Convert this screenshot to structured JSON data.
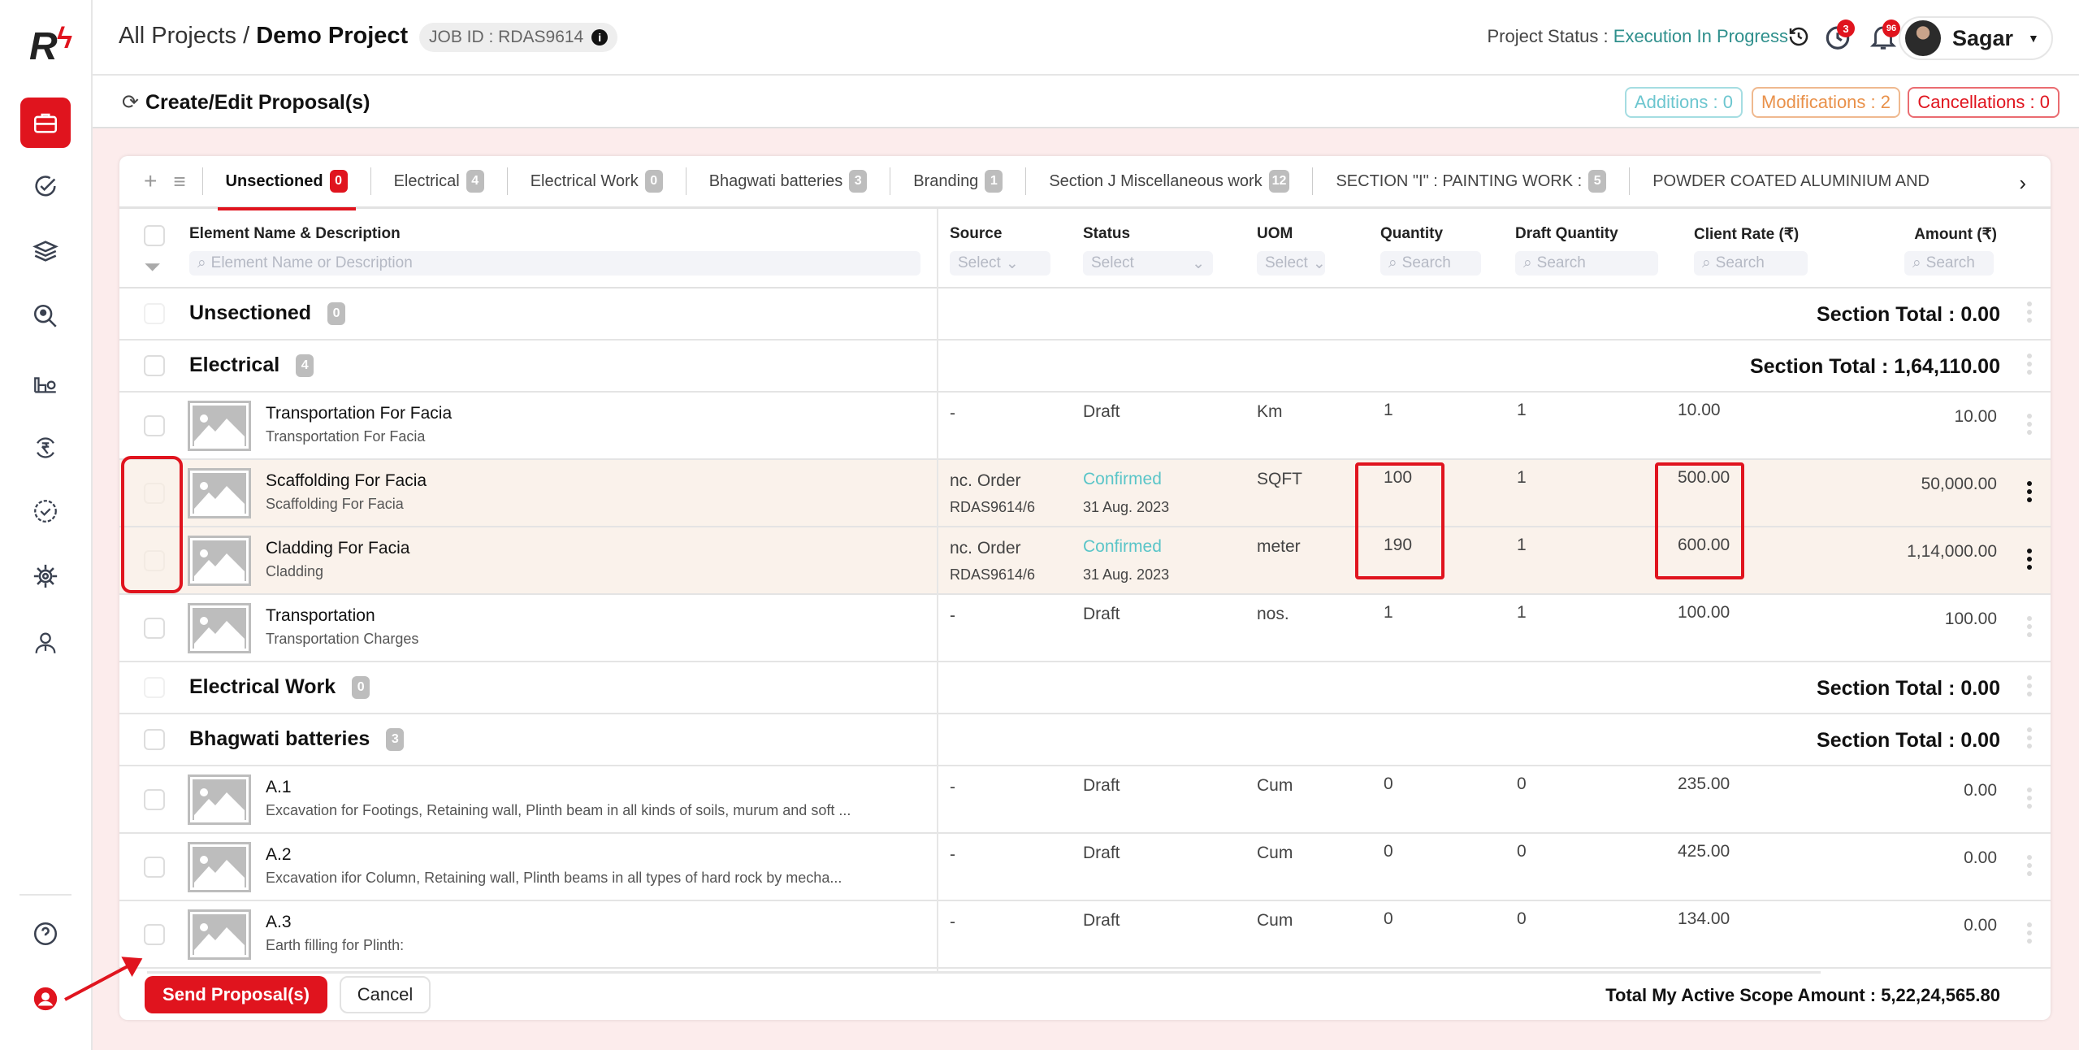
{
  "header": {
    "breadcrumb_root": "All Projects",
    "breadcrumb_sep": "/",
    "project_name": "Demo Project",
    "job_id": "JOB ID : RDAS9614",
    "status_label": "Project Status : ",
    "status_value": "Execution In Progress",
    "timer_badge": "3",
    "notification_badge": "96",
    "user_name": "Sagar"
  },
  "subheader": {
    "title": "Create/Edit Proposal(s)",
    "additions": "Additions : 0",
    "modifications": "Modifications : 2",
    "cancellations": "Cancellations : 0"
  },
  "colors": {
    "accent": "#e0141e",
    "status_teal": "#2e8f8c",
    "confirmed": "#5ac5c8",
    "additions": "#6cc6cf",
    "modifications": "#e9914a",
    "cancellations": "#e0141e"
  },
  "sidebar": {
    "items": [
      "projects-icon",
      "tasks-check-icon",
      "layers-icon",
      "people-search-icon",
      "site-worker-icon",
      "rupee-cycle-icon",
      "verified-badge-icon",
      "settings-network-icon",
      "user-manager-icon"
    ],
    "bottom": [
      "help-icon",
      "support-agent-icon"
    ]
  },
  "tabs": [
    {
      "label": "Unsectioned",
      "count": "0",
      "active": true
    },
    {
      "label": "Electrical",
      "count": "4"
    },
    {
      "label": "Electrical Work",
      "count": "0"
    },
    {
      "label": "Bhagwati batteries",
      "count": "3"
    },
    {
      "label": "Branding",
      "count": "1"
    },
    {
      "label": "Section J Miscellaneous work",
      "count": "12"
    },
    {
      "label": "SECTION \"I\" : PAINTING WORK :",
      "count": "5"
    },
    {
      "label": "POWDER COATED ALUMINIUM AND GLA",
      "count": ""
    }
  ],
  "columns": {
    "name": "Element Name & Description",
    "name_placeholder": "Element Name or Description",
    "source": "Source",
    "status": "Status",
    "uom": "UOM",
    "quantity": "Quantity",
    "draft_quantity": "Draft Quantity",
    "client_rate": "Client Rate (₹)",
    "amount": "Amount (₹)",
    "select": "Select",
    "search": "Search"
  },
  "sections": {
    "unsectioned": {
      "name": "Unsectioned",
      "count": "0",
      "total": "Section Total : 0.00"
    },
    "electrical": {
      "name": "Electrical",
      "count": "4",
      "total": "Section Total : 1,64,110.00"
    },
    "electrical_work": {
      "name": "Electrical Work",
      "count": "0",
      "total": "Section Total : 0.00"
    },
    "bhagwati": {
      "name": "Bhagwati batteries",
      "count": "3",
      "total": "Section Total : 0.00"
    }
  },
  "items": [
    {
      "name": "Transportation For Facia",
      "desc": "Transportation For Facia",
      "source": "-",
      "source2": "",
      "status": "Draft",
      "date": "",
      "uom": "Km",
      "qty": "1",
      "draft_qty": "1",
      "rate": "10.00",
      "amount": "10.00"
    },
    {
      "name": "Scaffolding For Facia",
      "desc": "Scaffolding For Facia",
      "source": "nc. Order",
      "source2": "RDAS9614/6",
      "status": "Confirmed",
      "date": "31 Aug. 2023",
      "uom": "SQFT",
      "qty": "100",
      "draft_qty": "1",
      "rate": "500.00",
      "amount": "50,000.00"
    },
    {
      "name": "Cladding For Facia",
      "desc": "Cladding",
      "source": "nc. Order",
      "source2": "RDAS9614/6",
      "status": "Confirmed",
      "date": "31 Aug. 2023",
      "uom": "meter",
      "qty": "190",
      "draft_qty": "1",
      "rate": "600.00",
      "amount": "1,14,000.00"
    },
    {
      "name": "Transportation",
      "desc": "Transportation Charges",
      "source": "-",
      "source2": "",
      "status": "Draft",
      "date": "",
      "uom": "nos.",
      "qty": "1",
      "draft_qty": "1",
      "rate": "100.00",
      "amount": "100.00"
    },
    {
      "name": "A.1",
      "desc": "Excavation for Footings, Retaining wall, Plinth beam in all kinds of soils, murum and soft ...",
      "source": "-",
      "source2": "",
      "status": "Draft",
      "date": "",
      "uom": "Cum",
      "qty": "0",
      "draft_qty": "0",
      "rate": "235.00",
      "amount": "0.00"
    },
    {
      "name": "A.2",
      "desc": "Excavation ifor Column, Retaining wall, Plinth beams in all types of hard rock by mecha...",
      "source": "-",
      "source2": "",
      "status": "Draft",
      "date": "",
      "uom": "Cum",
      "qty": "0",
      "draft_qty": "0",
      "rate": "425.00",
      "amount": "0.00"
    },
    {
      "name": "A.3",
      "desc": "Earth filling for Plinth:",
      "source": "-",
      "source2": "",
      "status": "Draft",
      "date": "",
      "uom": "Cum",
      "qty": "0",
      "draft_qty": "0",
      "rate": "134.00",
      "amount": "0.00"
    }
  ],
  "footer": {
    "send_label": "Send Proposal(s)",
    "cancel_label": "Cancel",
    "total_active": "Total My Active Scope Amount : 5,22,24,565.80"
  }
}
